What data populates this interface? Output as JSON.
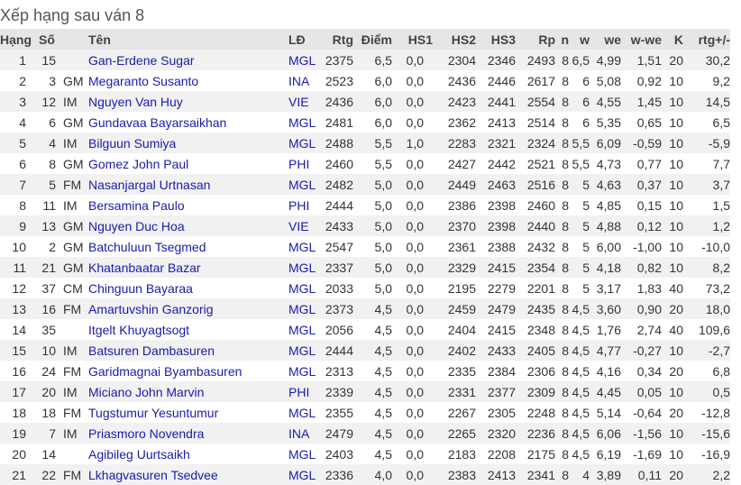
{
  "title": "Xếp hạng sau ván 8",
  "headers": [
    "Hạng",
    "Số",
    "",
    "Tên",
    "LĐ",
    "Rtg",
    "Điểm",
    "HS1",
    "HS2",
    "HS3",
    "Rp",
    "n",
    "w",
    "we",
    "w-we",
    "K",
    "rtg+/-"
  ],
  "rows": [
    [
      "1",
      "15",
      "",
      "Gan-Erdene Sugar",
      "MGL",
      "2375",
      "6,5",
      "0,0",
      "2304",
      "2346",
      "2493",
      "8",
      "6,5",
      "4,99",
      "1,51",
      "20",
      "30,2"
    ],
    [
      "2",
      "3",
      "GM",
      "Megaranto Susanto",
      "INA",
      "2523",
      "6,0",
      "0,0",
      "2436",
      "2446",
      "2617",
      "8",
      "6",
      "5,08",
      "0,92",
      "10",
      "9,2"
    ],
    [
      "3",
      "12",
      "IM",
      "Nguyen Van Huy",
      "VIE",
      "2436",
      "6,0",
      "0,0",
      "2423",
      "2441",
      "2554",
      "8",
      "6",
      "4,55",
      "1,45",
      "10",
      "14,5"
    ],
    [
      "4",
      "6",
      "GM",
      "Gundavaa Bayarsaikhan",
      "MGL",
      "2481",
      "6,0",
      "0,0",
      "2362",
      "2413",
      "2514",
      "8",
      "6",
      "5,35",
      "0,65",
      "10",
      "6,5"
    ],
    [
      "5",
      "4",
      "IM",
      "Bilguun Sumiya",
      "MGL",
      "2488",
      "5,5",
      "1,0",
      "2283",
      "2321",
      "2324",
      "8",
      "5,5",
      "6,09",
      "-0,59",
      "10",
      "-5,9"
    ],
    [
      "6",
      "8",
      "GM",
      "Gomez John Paul",
      "PHI",
      "2460",
      "5,5",
      "0,0",
      "2427",
      "2442",
      "2521",
      "8",
      "5,5",
      "4,73",
      "0,77",
      "10",
      "7,7"
    ],
    [
      "7",
      "5",
      "FM",
      "Nasanjargal Urtnasan",
      "MGL",
      "2482",
      "5,0",
      "0,0",
      "2449",
      "2463",
      "2516",
      "8",
      "5",
      "4,63",
      "0,37",
      "10",
      "3,7"
    ],
    [
      "8",
      "11",
      "IM",
      "Bersamina Paulo",
      "PHI",
      "2444",
      "5,0",
      "0,0",
      "2386",
      "2398",
      "2460",
      "8",
      "5",
      "4,85",
      "0,15",
      "10",
      "1,5"
    ],
    [
      "9",
      "13",
      "GM",
      "Nguyen Duc Hoa",
      "VIE",
      "2433",
      "5,0",
      "0,0",
      "2370",
      "2398",
      "2440",
      "8",
      "5",
      "4,88",
      "0,12",
      "10",
      "1,2"
    ],
    [
      "10",
      "2",
      "GM",
      "Batchuluun Tsegmed",
      "MGL",
      "2547",
      "5,0",
      "0,0",
      "2361",
      "2388",
      "2432",
      "8",
      "5",
      "6,00",
      "-1,00",
      "10",
      "-10,0"
    ],
    [
      "11",
      "21",
      "GM",
      "Khatanbaatar Bazar",
      "MGL",
      "2337",
      "5,0",
      "0,0",
      "2329",
      "2415",
      "2354",
      "8",
      "5",
      "4,18",
      "0,82",
      "10",
      "8,2"
    ],
    [
      "12",
      "37",
      "CM",
      "Chinguun Bayaraa",
      "MGL",
      "2033",
      "5,0",
      "0,0",
      "2195",
      "2279",
      "2201",
      "8",
      "5",
      "3,17",
      "1,83",
      "40",
      "73,2"
    ],
    [
      "13",
      "16",
      "FM",
      "Amartuvshin Ganzorig",
      "MGL",
      "2373",
      "4,5",
      "0,0",
      "2459",
      "2479",
      "2435",
      "8",
      "4,5",
      "3,60",
      "0,90",
      "20",
      "18,0"
    ],
    [
      "14",
      "35",
      "",
      "Itgelt Khuyagtsogt",
      "MGL",
      "2056",
      "4,5",
      "0,0",
      "2404",
      "2415",
      "2348",
      "8",
      "4,5",
      "1,76",
      "2,74",
      "40",
      "109,6"
    ],
    [
      "15",
      "10",
      "IM",
      "Batsuren Dambasuren",
      "MGL",
      "2444",
      "4,5",
      "0,0",
      "2402",
      "2433",
      "2405",
      "8",
      "4,5",
      "4,77",
      "-0,27",
      "10",
      "-2,7"
    ],
    [
      "16",
      "24",
      "FM",
      "Garidmagnai Byambasuren",
      "MGL",
      "2313",
      "4,5",
      "0,0",
      "2335",
      "2384",
      "2306",
      "8",
      "4,5",
      "4,16",
      "0,34",
      "20",
      "6,8"
    ],
    [
      "17",
      "20",
      "IM",
      "Miciano John Marvin",
      "PHI",
      "2339",
      "4,5",
      "0,0",
      "2331",
      "2377",
      "2309",
      "8",
      "4,5",
      "4,45",
      "0,05",
      "10",
      "0,5"
    ],
    [
      "18",
      "18",
      "FM",
      "Tugstumur Yesuntumur",
      "MGL",
      "2355",
      "4,5",
      "0,0",
      "2267",
      "2305",
      "2248",
      "8",
      "4,5",
      "5,14",
      "-0,64",
      "20",
      "-12,8"
    ],
    [
      "19",
      "7",
      "IM",
      "Priasmoro Novendra",
      "INA",
      "2479",
      "4,5",
      "0,0",
      "2265",
      "2320",
      "2236",
      "8",
      "4,5",
      "6,06",
      "-1,56",
      "10",
      "-15,6"
    ],
    [
      "20",
      "14",
      "",
      "Agibileg Uurtsaikh",
      "MGL",
      "2403",
      "4,5",
      "0,0",
      "2183",
      "2208",
      "2175",
      "8",
      "4,5",
      "6,19",
      "-1,69",
      "10",
      "-16,9"
    ],
    [
      "21",
      "22",
      "FM",
      "Lkhagvasuren Tsedvee",
      "MGL",
      "2336",
      "4,0",
      "0,0",
      "2383",
      "2413",
      "2341",
      "8",
      "4",
      "3,89",
      "0,11",
      "20",
      "2,2"
    ]
  ]
}
